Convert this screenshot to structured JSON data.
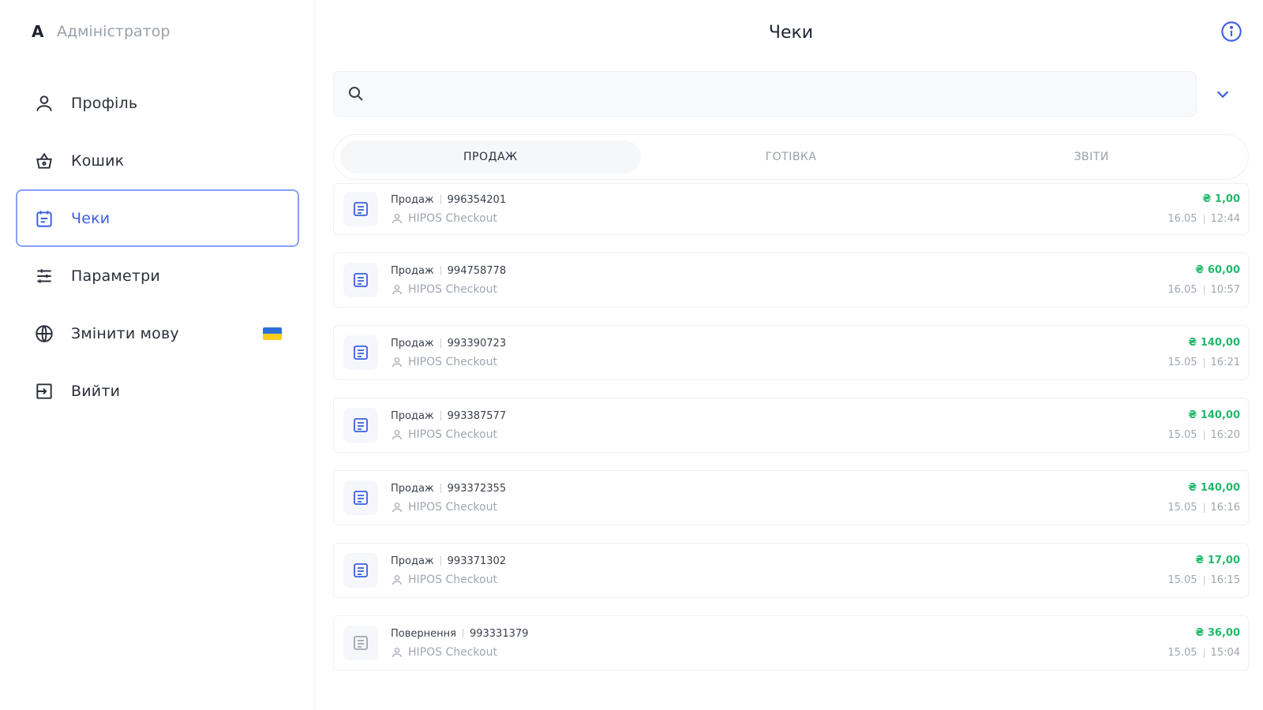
{
  "user": {
    "letter": "A",
    "name": "Адміністратор"
  },
  "sidebar": {
    "items": [
      {
        "label": "Профіль"
      },
      {
        "label": "Кошик"
      },
      {
        "label": "Чеки"
      },
      {
        "label": "Параметри"
      },
      {
        "label": "Змінити мову"
      },
      {
        "label": "Вийти"
      }
    ]
  },
  "header": {
    "title": "Чеки"
  },
  "search": {
    "placeholder": ""
  },
  "tabs": [
    {
      "label": "ПРОДАЖ"
    },
    {
      "label": "ГОТІВКА"
    },
    {
      "label": "ЗВІТИ"
    }
  ],
  "receipts": [
    {
      "type": "Продаж",
      "number": "996354201",
      "cashier": "HIPOS Checkout",
      "amount": "₴ 1,00",
      "date": "16.05",
      "time": "12:44"
    },
    {
      "type": "Продаж",
      "number": "994758778",
      "cashier": "HIPOS Checkout",
      "amount": "₴ 60,00",
      "date": "16.05",
      "time": "10:57"
    },
    {
      "type": "Продаж",
      "number": "993390723",
      "cashier": "HIPOS Checkout",
      "amount": "₴ 140,00",
      "date": "15.05",
      "time": "16:21"
    },
    {
      "type": "Продаж",
      "number": "993387577",
      "cashier": "HIPOS Checkout",
      "amount": "₴ 140,00",
      "date": "15.05",
      "time": "16:20"
    },
    {
      "type": "Продаж",
      "number": "993372355",
      "cashier": "HIPOS Checkout",
      "amount": "₴ 140,00",
      "date": "15.05",
      "time": "16:16"
    },
    {
      "type": "Продаж",
      "number": "993371302",
      "cashier": "HIPOS Checkout",
      "amount": "₴ 17,00",
      "date": "15.05",
      "time": "16:15"
    },
    {
      "type": "Повернення",
      "number": "993331379",
      "cashier": "HIPOS Checkout",
      "amount": "₴ 36,00",
      "date": "15.05",
      "time": "15:04"
    }
  ],
  "colors": {
    "accent": "#3b5fe0",
    "active_border": "#8aa1f7",
    "amount": "#22b86b",
    "return_icon": "#a0a6b0"
  }
}
